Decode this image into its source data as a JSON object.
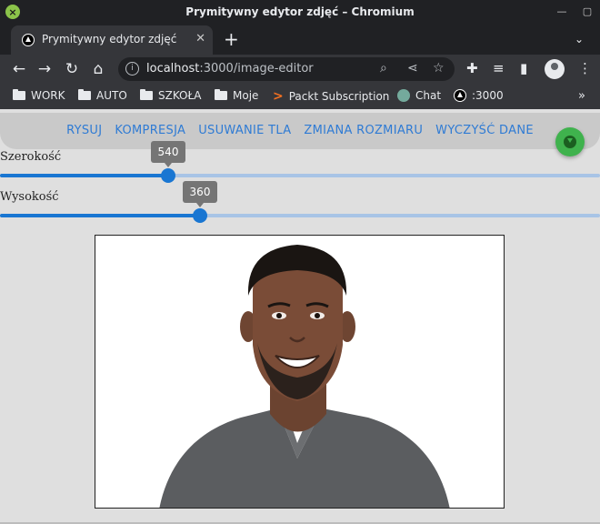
{
  "window": {
    "title": "Prymitywny edytor zdjęć – Chromium"
  },
  "tab": {
    "title": "Prymitywny edytor zdjęć"
  },
  "address": {
    "host": "localhost",
    "path": ":3000/image-editor"
  },
  "bookmarks": [
    "WORK",
    "AUTO",
    "SZKOŁA",
    "Moje",
    "Packt Subscription",
    "Chat",
    ":3000"
  ],
  "nav": {
    "items": [
      "RYSUJ",
      "KOMPRESJA",
      "USUWANIE TLA",
      "ZMIANA ROZMIARU",
      "WYCZYŚĆ DANE"
    ]
  },
  "sliders": {
    "width": {
      "label": "Szerokość",
      "value": "540",
      "fraction": 0.28
    },
    "height": {
      "label": "Wysokość",
      "value": "360",
      "fraction": 0.333
    }
  },
  "colors": {
    "accent": "#1976d2",
    "menu": "#2f7bd4",
    "fab": "#3fb24d"
  },
  "icons": {
    "fab": "download-icon"
  }
}
